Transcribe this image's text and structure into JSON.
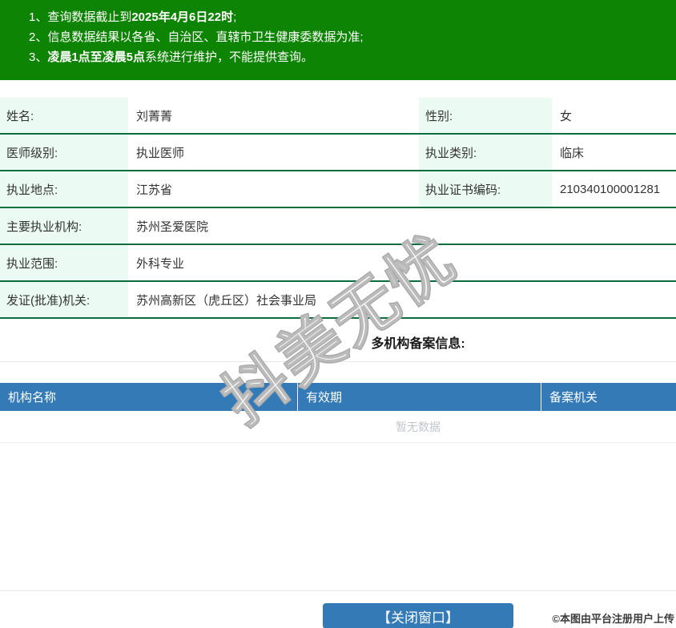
{
  "banner": {
    "lines": [
      {
        "pre": "1、查询数据截止到",
        "bold": "2025年4月6日22时",
        "post": ";"
      },
      {
        "pre": "2、信息数据结果以各省、自治区、直辖市卫生健康委数据为准;",
        "bold": "",
        "post": ""
      },
      {
        "pre": "3、",
        "bold": "凌晨1点至凌晨5点",
        "post": "系统进行维护，不能提供查询。"
      }
    ]
  },
  "info": {
    "name_label": "姓名:",
    "name": "刘菁菁",
    "gender_label": "性别:",
    "gender": "女",
    "level_label": "医师级别:",
    "level": "执业医师",
    "category_label": "执业类别:",
    "category": "临床",
    "place_label": "执业地点:",
    "place": "江苏省",
    "cert_label": "执业证书编码:",
    "cert": "210340100001281",
    "org_label": "主要执业机构:",
    "org": "苏州圣爱医院",
    "scope_label": "执业范围:",
    "scope": "外科专业",
    "issuer_label": "发证(批准)机关:",
    "issuer": "苏州高新区（虎丘区）社会事业局"
  },
  "multi_org": {
    "title": "多机构备案信息:",
    "headers": [
      "机构名称",
      "有效期",
      "备案机关"
    ],
    "empty_text": "暂无数据"
  },
  "footer": {
    "close_button": "【关闭窗口】"
  },
  "overlays": {
    "watermark": "抖美无忧",
    "copyright": "©本图由平台注册用户上传"
  },
  "colors": {
    "banner_green": "#0e8404",
    "row_border_green": "#0b6e3e",
    "label_bg_mint": "#ebfbf3",
    "table_header_blue": "#337ab7",
    "button_blue": "#337ab7",
    "empty_text_gray": "#c0c4cc",
    "text_dark": "#333333"
  }
}
